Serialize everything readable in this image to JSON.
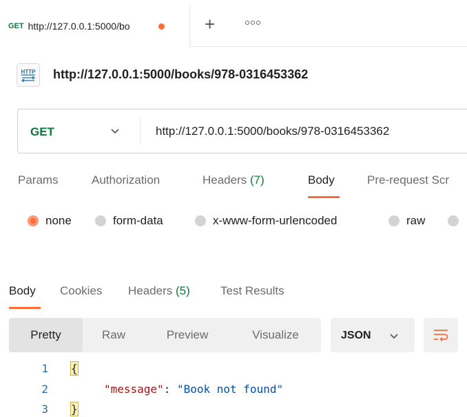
{
  "tab": {
    "method": "GET",
    "title": "http://127.0.0.1:5000/bo",
    "unsaved_color": "#ff6c37",
    "new_tab_icon": "plus-icon",
    "more_icon": "ellipsis-icon"
  },
  "request": {
    "title": "http://127.0.0.1:5000/books/978-0316453362",
    "icon": "http-icon",
    "method": "GET",
    "url": "http://127.0.0.1:5000/books/978-0316453362"
  },
  "request_tabs": [
    {
      "label": "Params",
      "count": ""
    },
    {
      "label": "Authorization",
      "count": ""
    },
    {
      "label": "Headers ",
      "count": "(7)"
    },
    {
      "label": "Body",
      "count": ""
    },
    {
      "label": "Pre-request Scr",
      "count": ""
    }
  ],
  "body_types": [
    {
      "label": "none",
      "checked": true
    },
    {
      "label": "form-data",
      "checked": false
    },
    {
      "label": "x-www-form-urlencoded",
      "checked": false
    },
    {
      "label": "raw",
      "checked": false
    }
  ],
  "response_tabs": [
    {
      "label": "Body",
      "count": ""
    },
    {
      "label": "Cookies",
      "count": ""
    },
    {
      "label": "Headers ",
      "count": "(5)"
    },
    {
      "label": "Test Results",
      "count": ""
    }
  ],
  "view_modes": [
    "Pretty",
    "Raw",
    "Preview",
    "Visualize"
  ],
  "format": "JSON",
  "code": {
    "line_numbers": [
      "1",
      "2",
      "3"
    ],
    "open_brace": "{",
    "key": "\"message\"",
    "colon": ": ",
    "value": "\"Book not found\"",
    "close_brace": "}"
  },
  "colors": {
    "accent": "#ff6c37",
    "method_get": "#0b7a3b",
    "count": "#0b7a3b"
  }
}
